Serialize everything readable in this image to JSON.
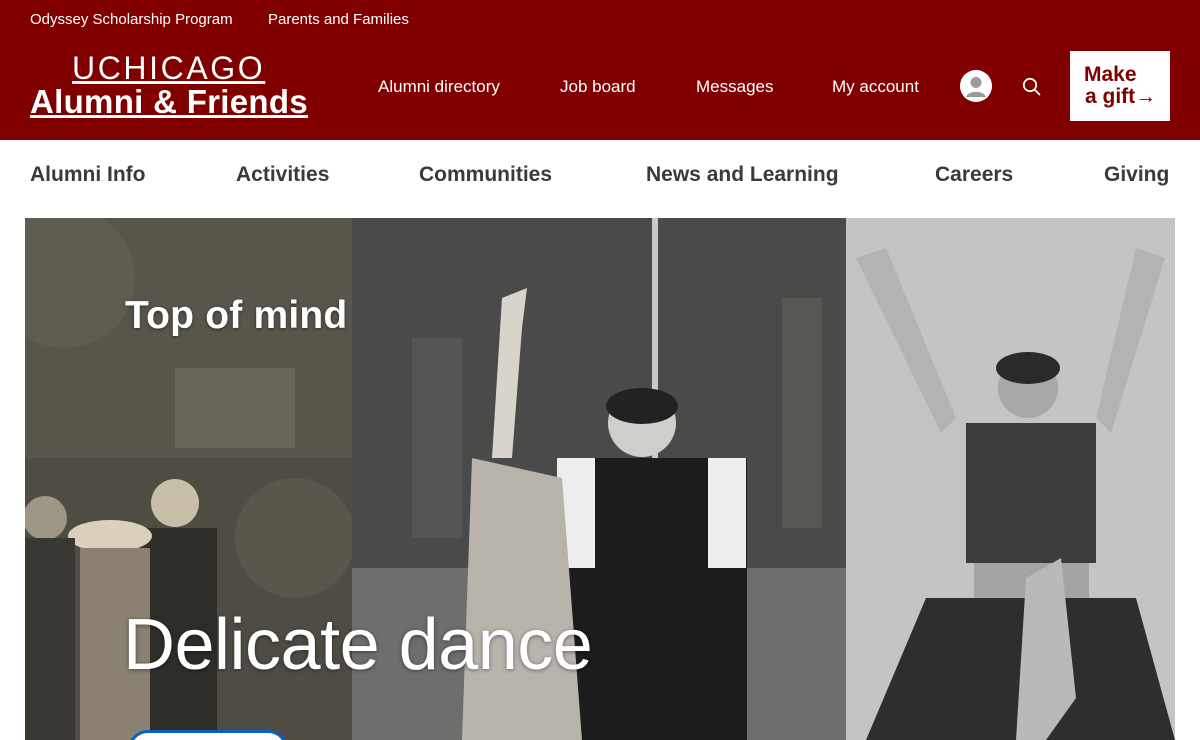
{
  "utility_nav": [
    "Odyssey Scholarship Program",
    "Parents and Families"
  ],
  "logo": {
    "top": "UCHICAGO",
    "bottom": "Alumni & Friends"
  },
  "main_nav": [
    "Alumni directory",
    "Job board",
    "Messages",
    "My account"
  ],
  "gift_button": {
    "line1": "Make",
    "line2": "a gift",
    "arrow": "→"
  },
  "secondary_nav": [
    "Alumni Info",
    "Activities",
    "Communities",
    "News and Learning",
    "Careers",
    "Giving"
  ],
  "hero": {
    "eyebrow": "Top of mind",
    "title": "Delicate dance"
  },
  "colors": {
    "brand_maroon": "#800000",
    "white": "#ffffff",
    "cta_blue": "#0b5fc7",
    "nav_text": "#3a3a3a"
  },
  "icons": {
    "account": "user-avatar-icon",
    "search": "search-icon",
    "gift_arrow": "arrow-right-icon"
  }
}
